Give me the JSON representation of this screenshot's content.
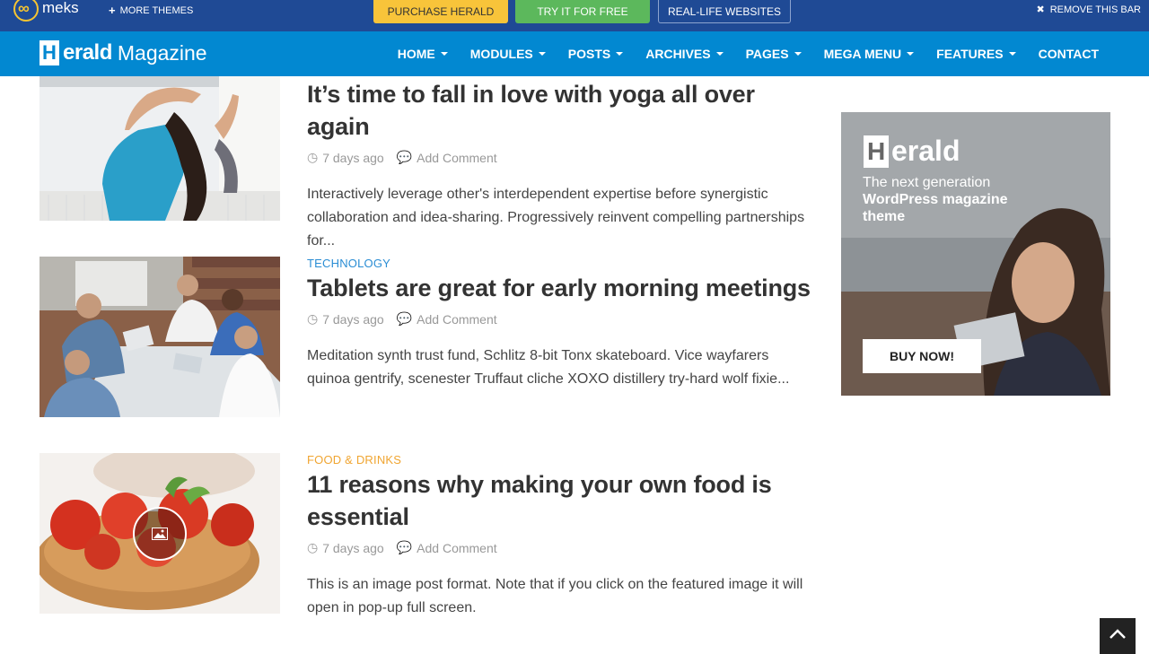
{
  "topbar": {
    "brand": "meks",
    "more_themes": "MORE THEMES",
    "purchase": "PURCHASE HERALD",
    "try_free": "TRY IT FOR FREE",
    "real_life": "REAL-LIFE WEBSITES",
    "remove_bar": "REMOVE THIS BAR"
  },
  "header": {
    "logo_bold": "erald",
    "logo_light": "Magazine",
    "nav": [
      {
        "label": "HOME",
        "has_dropdown": true
      },
      {
        "label": "MODULES",
        "has_dropdown": true
      },
      {
        "label": "POSTS",
        "has_dropdown": true
      },
      {
        "label": "ARCHIVES",
        "has_dropdown": true
      },
      {
        "label": "PAGES",
        "has_dropdown": true
      },
      {
        "label": "MEGA MENU",
        "has_dropdown": true
      },
      {
        "label": "FEATURES",
        "has_dropdown": true
      },
      {
        "label": "CONTACT",
        "has_dropdown": false
      }
    ]
  },
  "posts": [
    {
      "category": "",
      "title": "It’s time to fall in love with yoga all over again",
      "date": "7 days ago",
      "comments": "Add Comment",
      "excerpt": "Interactively leverage other's interdependent expertise before synergistic collaboration and idea-sharing. Progressively reinvent compelling partnerships for..."
    },
    {
      "category": "TECHNOLOGY",
      "title": "Tablets are great for early morning meetings",
      "date": "7 days ago",
      "comments": "Add Comment",
      "excerpt": "Meditation synth trust fund, Schlitz 8-bit Tonx skateboard. Vice wayfarers quinoa gentrify, scenester Truffaut cliche XOXO distillery try-hard wolf fixie..."
    },
    {
      "category": "FOOD & DRINKS",
      "title": "11 reasons why making your own food is essential",
      "date": "7 days ago",
      "comments": "Add Comment",
      "excerpt": "This is an image post format. Note that if you click on the featured image it will open in pop-up full screen."
    }
  ],
  "ad": {
    "logo": "erald",
    "line1": "The next generation",
    "line2": "WordPress magazine",
    "line3": "theme",
    "button": "BUY NOW!"
  },
  "colors": {
    "topbar_bg": "#1f4a95",
    "header_bg": "#0288d1",
    "purchase": "#f8c43a",
    "try_free": "#5cb85c",
    "tech_category": "#2a8dd4",
    "food_category": "#f0a531"
  },
  "icons": [
    "clock-icon",
    "comment-icon",
    "image-format-icon",
    "close-icon",
    "plus-icon",
    "arrow-up-icon"
  ]
}
